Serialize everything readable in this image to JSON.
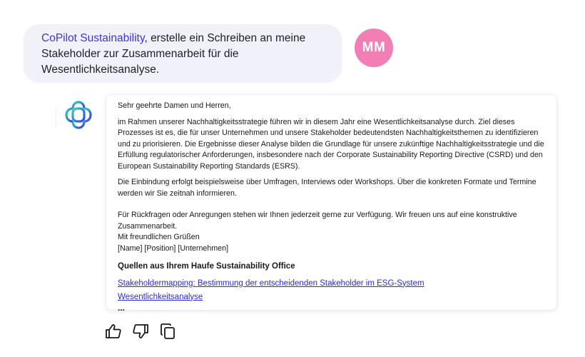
{
  "user_message": {
    "mention": "CoPilot Sustainability",
    "text_line1": ", erstelle ein Schreiben an meine",
    "text_line2": "Stakeholder zur Zusammenarbeit für die",
    "text_line3": "Wesentlichkeitsanalyse."
  },
  "avatar": {
    "initials": "MM",
    "color": "#f27eb6"
  },
  "assistant": {
    "logo_icon": "copilot-flower-logo",
    "greeting": "Sehr geehrte Damen und Herren,",
    "para1": "im Rahmen unserer Nachhaltigkeitsstrategie führen wir in diesem Jahr eine Wesentlichkeitsanalyse durch. Ziel dieses Prozesses ist es, die für unser Unternehmen und unsere Stakeholder bedeutendsten Nachhaltigkeitsthemen zu identifizieren und zu priorisieren. Die Ergebnisse dieser Analyse bilden die Grundlage für unsere zukünftige Nachhaltigkeitsstrategie und die Erfüllung regulatorischer Anforderungen, insbesondere nach der Corporate Sustainability Reporting Directive (CSRD) und den European Sustainability Reporting Standards (ESRS).",
    "para2": "Die Einbindung erfolgt beispielsweise über Umfragen, Interviews oder Workshops. Über die konkreten Formate und Termine werden wir Sie zeitnah informieren.",
    "para3": "Für Rückfragen oder Anregungen stehen wir Ihnen jederzeit gerne zur Verfügung. Wir freuen uns auf eine konstruktive Zusammenarbeit.",
    "closing": "Mit freundlichen Grüßen",
    "signature": "[Name] [Position] [Unternehmen]",
    "sources_title": "Quellen aus Ihrem Haufe Sustainability Office",
    "sources": [
      "Stakeholdermapping: Bestimmung der entscheidenden Stakeholder im ESG-System",
      "Wesentlichkeitsanalyse"
    ],
    "more": "..."
  },
  "actions": {
    "icons": [
      "thumbs-up-icon",
      "thumbs-down-icon",
      "copy-icon"
    ]
  },
  "colors": {
    "accent": "#3d35d8",
    "bubble_bg": "#f1f1fa",
    "logo_teal": "#2fc6c6",
    "logo_blue": "#3a44e0"
  }
}
